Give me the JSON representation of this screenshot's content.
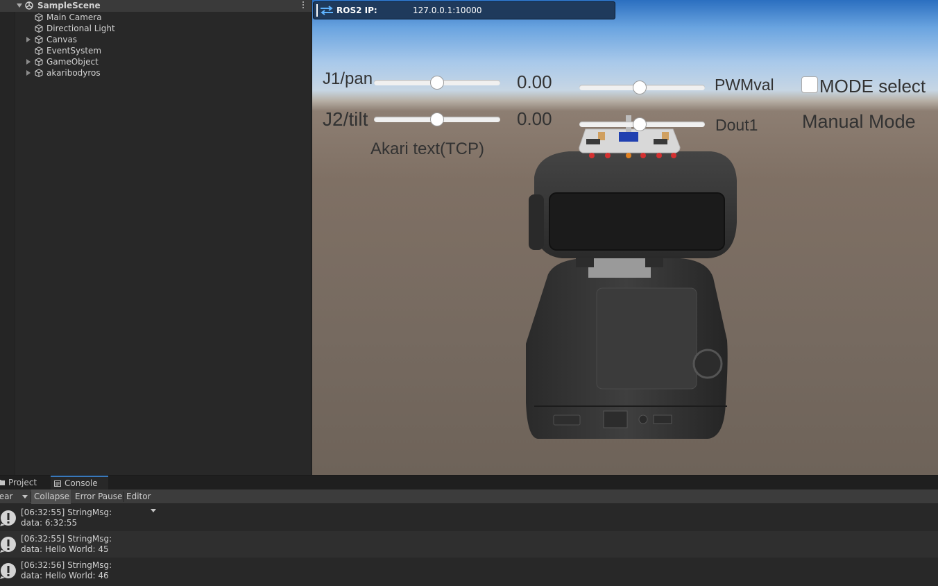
{
  "hierarchy": {
    "scene": "SampleScene",
    "items": [
      {
        "label": "Main Camera",
        "expandable": false
      },
      {
        "label": "Directional Light",
        "expandable": false
      },
      {
        "label": "Canvas",
        "expandable": true
      },
      {
        "label": "EventSystem",
        "expandable": false
      },
      {
        "label": "GameObject",
        "expandable": true
      },
      {
        "label": "akaribodyros",
        "expandable": true
      }
    ]
  },
  "game": {
    "ros": {
      "label": "ROS2 IP:",
      "value": "127.0.0.1:10000"
    },
    "j1": {
      "label": "J1/pan",
      "value": "0.00",
      "slider": 0.5
    },
    "j2": {
      "label": "J2/tilt",
      "value": "0.00",
      "slider": 0.5
    },
    "akari_text": "Akari text(TCP)",
    "pwm": {
      "label": "PWMval",
      "slider": 0.5
    },
    "dout1": {
      "label": "Dout1",
      "slider": 0.5
    },
    "mode_select": {
      "label": "MODE select",
      "checked": false
    },
    "mode_status": "Manual Mode"
  },
  "console": {
    "tabs": [
      {
        "label": "Project",
        "icon": "folder-icon",
        "active": false
      },
      {
        "label": "Console",
        "icon": "console-icon",
        "active": true
      }
    ],
    "toolbar": {
      "clear": "Clear",
      "collapse": "Collapse",
      "error_pause": "Error Pause",
      "editor": "Editor"
    },
    "logs": [
      {
        "line1": "[06:32:55] StringMsg:",
        "line2": "data: 6:32:55"
      },
      {
        "line1": "[06:32:55] StringMsg:",
        "line2": "data: Hello World: 45"
      },
      {
        "line1": "[06:32:56] StringMsg:",
        "line2": "data: Hello World: 46"
      }
    ]
  },
  "colors": {
    "accent": "#3a79bb",
    "panel": "#282828",
    "ros_bar": "#1f3a5c"
  }
}
